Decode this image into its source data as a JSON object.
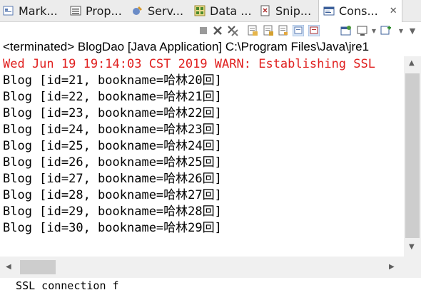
{
  "tabs": [
    {
      "label": "Mark...",
      "icon": "markers-icon",
      "active": false
    },
    {
      "label": "Prop...",
      "icon": "properties-icon",
      "active": false
    },
    {
      "label": "Serv...",
      "icon": "servers-icon",
      "active": false
    },
    {
      "label": "Data ...",
      "icon": "data-source-icon",
      "active": false
    },
    {
      "label": "Snip...",
      "icon": "snippets-icon",
      "active": false
    },
    {
      "label": "Cons...",
      "icon": "console-icon",
      "active": true
    }
  ],
  "console": {
    "terminated_label": "<terminated> BlogDao [Java Application] C:\\Program Files\\Java\\jre1",
    "warn_line": "Wed Jun 19 19:14:03 CST 2019 WARN: Establishing SSL",
    "lines": [
      "Blog [id=21, bookname=哈林20回]",
      "Blog [id=22, bookname=哈林21回]",
      "Blog [id=23, bookname=哈林22回]",
      "Blog [id=24, bookname=哈林23回]",
      "Blog [id=25, bookname=哈林24回]",
      "Blog [id=26, bookname=哈林25回]",
      "Blog [id=27, bookname=哈林26回]",
      "Blog [id=28, bookname=哈林27回]",
      "Blog [id=29, bookname=哈林28回]",
      "Blog [id=30, bookname=哈林29回]"
    ],
    "partial_next": "  SSL connection f"
  },
  "colors": {
    "error_text": "#e0201f",
    "tab_bar": "#ececec"
  }
}
